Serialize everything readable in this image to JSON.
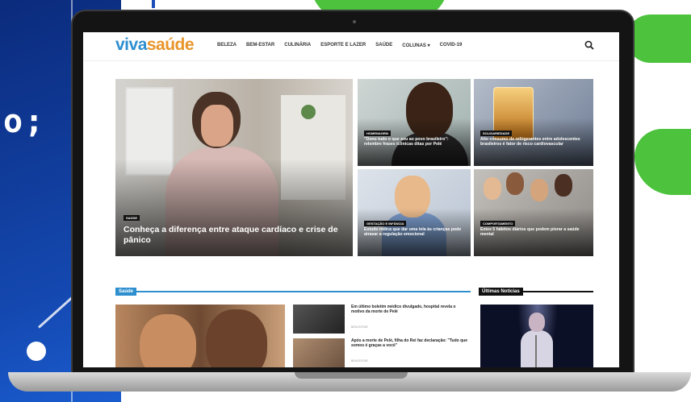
{
  "backdrop": {
    "overlay_text": "o;"
  },
  "site": {
    "logo_part1": "viva",
    "logo_part2": "saúde",
    "nav": [
      "BELEZA",
      "BEM-ESTAR",
      "CULINÁRIA",
      "ESPORTE E LAZER",
      "SAÚDE",
      "COLUNAS ▾",
      "COVID-19"
    ]
  },
  "featured": {
    "main": {
      "tag": "SAÚDE",
      "title": "Conheça a diferença entre ataque cardíaco e crise de pânico"
    },
    "tiles": [
      {
        "id": "pele",
        "tag": "HOMENAGEM",
        "title": "\"Dono tudo o que sou ao povo brasileiro\": relembre frases icônicas ditas por Pelé"
      },
      {
        "id": "soda",
        "tag": "SOLIDARIEDADE",
        "title": "Alto consumo de refrigerantes entre adolescentes brasileiros é fator de risco cardiovascular"
      },
      {
        "id": "child",
        "tag": "GESTAÇÃO E INFÂNCIA",
        "title": "Estudo indica que dar uma tela às crianças pode atrasar a regulação emocional"
      },
      {
        "id": "group",
        "tag": "COMPORTAMENTO",
        "title": "Estes 5 hábitos diários que podem piorar a saúde mental"
      }
    ]
  },
  "sections": {
    "saude": "Saúde",
    "latest": "Últimas Notícias"
  },
  "list": [
    {
      "text": "Em último boletim médico divulgado, hospital revela o motivo da morte de Pelé",
      "meta": "BEM-ESTAR"
    },
    {
      "text": "Após a morte de Pelé, filha do Rei faz declaração: \"Tudo que somos é graças a você\"",
      "meta": "BEM-ESTAR"
    }
  ],
  "colors": {
    "brand_blue": "#2e8fcf",
    "brand_orange": "#e8952b",
    "backdrop_blue": "#1747b4",
    "leaf_green": "#4cc23d"
  }
}
